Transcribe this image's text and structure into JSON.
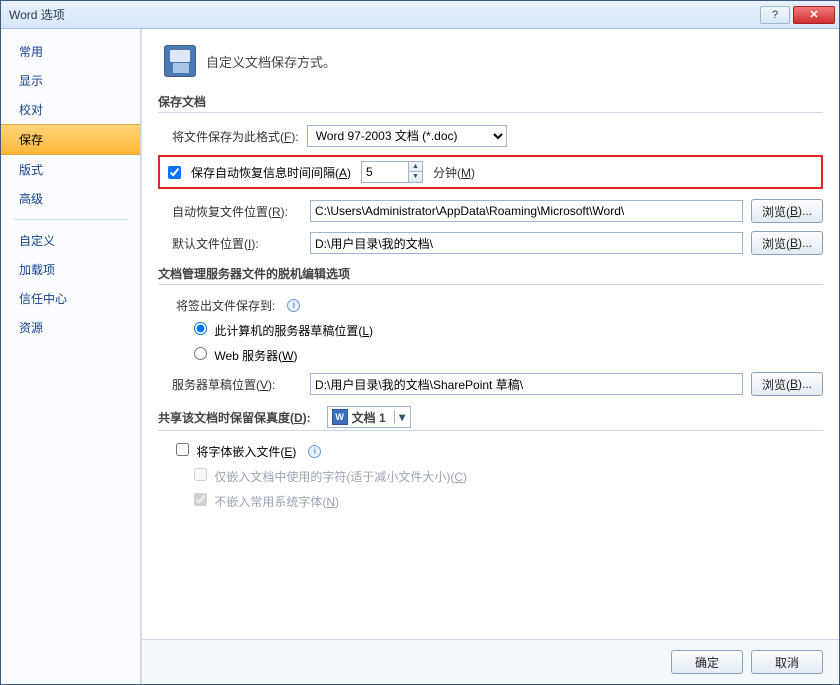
{
  "title": "Word 选项",
  "sidebar": {
    "items": [
      "常用",
      "显示",
      "校对",
      "保存",
      "版式",
      "高级"
    ],
    "items2": [
      "自定义",
      "加载项",
      "信任中心",
      "资源"
    ],
    "selected_index": 3
  },
  "header_text": "自定义文档保存方式。",
  "section1": {
    "title": "保存文档",
    "save_format_label": "将文件保存为此格式(F):",
    "save_format_value": "Word 97-2003 文档 (*.doc)",
    "autorecover_label": "保存自动恢复信息时间间隔(A)",
    "autorecover_value": "5",
    "autorecover_unit": "分钟(M)",
    "autorecover_path_label": "自动恢复文件位置(R):",
    "autorecover_path_value": "C:\\Users\\Administrator\\AppData\\Roaming\\Microsoft\\Word\\",
    "default_path_label": "默认文件位置(I):",
    "default_path_value": "D:\\用户目录\\我的文档\\",
    "browse_label": "浏览(B)..."
  },
  "section2": {
    "title": "文档管理服务器文件的脱机编辑选项",
    "save_to_label": "将签出文件保存到:",
    "opt_local": "此计算机的服务器草稿位置(L)",
    "opt_web": "Web 服务器(W)",
    "draft_loc_label": "服务器草稿位置(V):",
    "draft_loc_value": "D:\\用户目录\\我的文档\\SharePoint 草稿\\",
    "browse_label": "浏览(B)..."
  },
  "section3": {
    "title": "共享该文档时保留保真度(D):",
    "doc_name": "文档 1",
    "embed_label": "将字体嵌入文件(E)",
    "embed_sub1": "仅嵌入文档中使用的字符(适于减小文件大小)(C)",
    "embed_sub2": "不嵌入常用系统字体(N)"
  },
  "buttons": {
    "ok": "确定",
    "cancel": "取消"
  }
}
